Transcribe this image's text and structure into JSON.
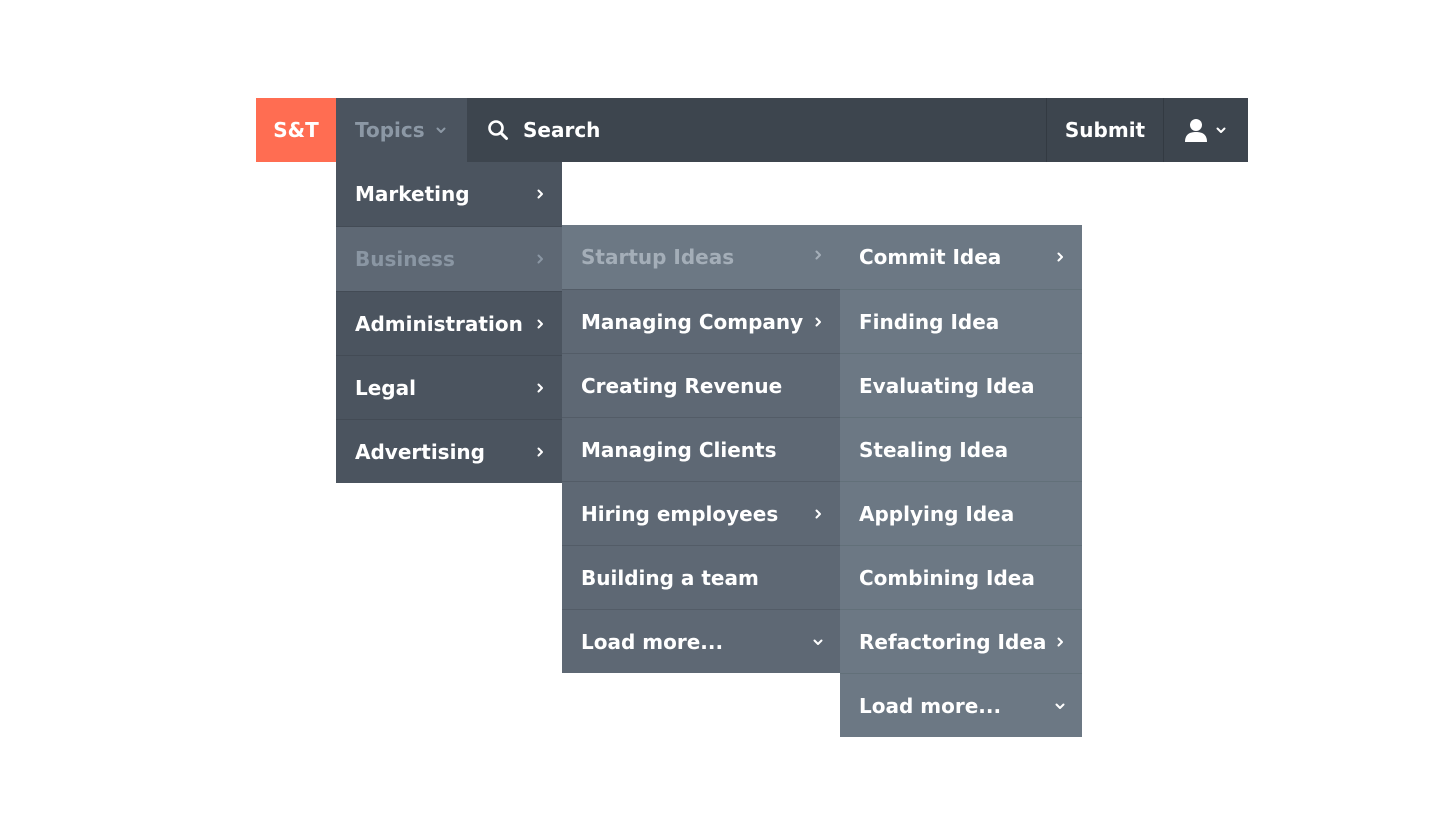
{
  "navbar": {
    "logo": "S&T",
    "topics_label": "Topics",
    "search_label": "Search",
    "submit_label": "Submit"
  },
  "menu_level1": [
    {
      "label": "Marketing",
      "has_submenu": true,
      "active": false
    },
    {
      "label": "Business",
      "has_submenu": true,
      "active": true
    },
    {
      "label": "Administration",
      "has_submenu": true,
      "active": false
    },
    {
      "label": "Legal",
      "has_submenu": true,
      "active": false
    },
    {
      "label": "Advertising",
      "has_submenu": true,
      "active": false
    }
  ],
  "menu_level2": [
    {
      "label": "Startup Ideas",
      "has_submenu": true,
      "active": true
    },
    {
      "label": "Managing Company",
      "has_submenu": true
    },
    {
      "label": "Creating Revenue",
      "has_submenu": false
    },
    {
      "label": "Managing Clients",
      "has_submenu": false
    },
    {
      "label": "Hiring employees",
      "has_submenu": true
    },
    {
      "label": "Building a team",
      "has_submenu": false
    },
    {
      "label": "Load more...",
      "load_more": true
    }
  ],
  "menu_level3": [
    {
      "label": "Commit Idea",
      "has_submenu": true
    },
    {
      "label": "Finding Idea",
      "has_submenu": false
    },
    {
      "label": "Evaluating Idea",
      "has_submenu": false
    },
    {
      "label": "Stealing Idea",
      "has_submenu": false
    },
    {
      "label": "Applying Idea",
      "has_submenu": false
    },
    {
      "label": "Combining Idea",
      "has_submenu": false
    },
    {
      "label": "Refactoring Idea",
      "has_submenu": true
    },
    {
      "label": "Load more...",
      "load_more": true
    }
  ],
  "colors": {
    "brand": "#ff6d52",
    "navbar": "#3d454e",
    "menu1": "#4b545f",
    "menu2": "#5e6874",
    "menu3": "#6c7884"
  },
  "icons": {
    "search": "search-icon",
    "user": "user-icon",
    "submenu": "chevron-right-icon",
    "dropdown": "chevron-down-icon"
  }
}
